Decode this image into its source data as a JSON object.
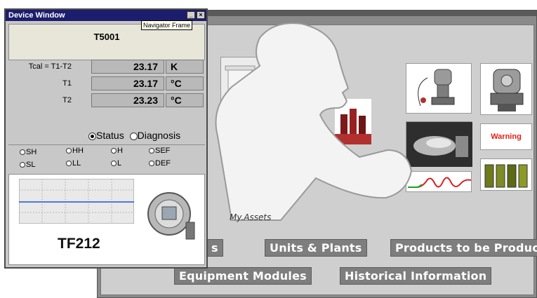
{
  "device_window": {
    "title": "Device Window",
    "tooltip": "Navigator Frame",
    "tag": "T5001",
    "measurements": [
      {
        "label": "Tcal = T1-T2",
        "value": "23.17",
        "unit": "K"
      },
      {
        "label": "T1",
        "value": "23.17",
        "unit": "°C"
      },
      {
        "label": "T2",
        "value": "23.23",
        "unit": "°C"
      }
    ],
    "view_options": {
      "status": "Status",
      "diagnosis": "Diagnosis",
      "selected": "status"
    },
    "alarms": {
      "row1": [
        "SH",
        "HH",
        "H",
        "SEF"
      ],
      "row2": [
        "SL",
        "LL",
        "L",
        "DEF"
      ]
    },
    "model": "TF212"
  },
  "navigator": {
    "my_assets": "My.Assets",
    "warning_text": "Warning",
    "buttons": {
      "partial": "s",
      "units_plants": "Units & Plants",
      "products": "Products to be Produced",
      "equipment": "Equipment Modules",
      "historical": "Historical Information"
    }
  },
  "colors": {
    "title_bar": "#1d1d6e",
    "warning": "#e02010",
    "trend_line": "#1a56d6"
  }
}
